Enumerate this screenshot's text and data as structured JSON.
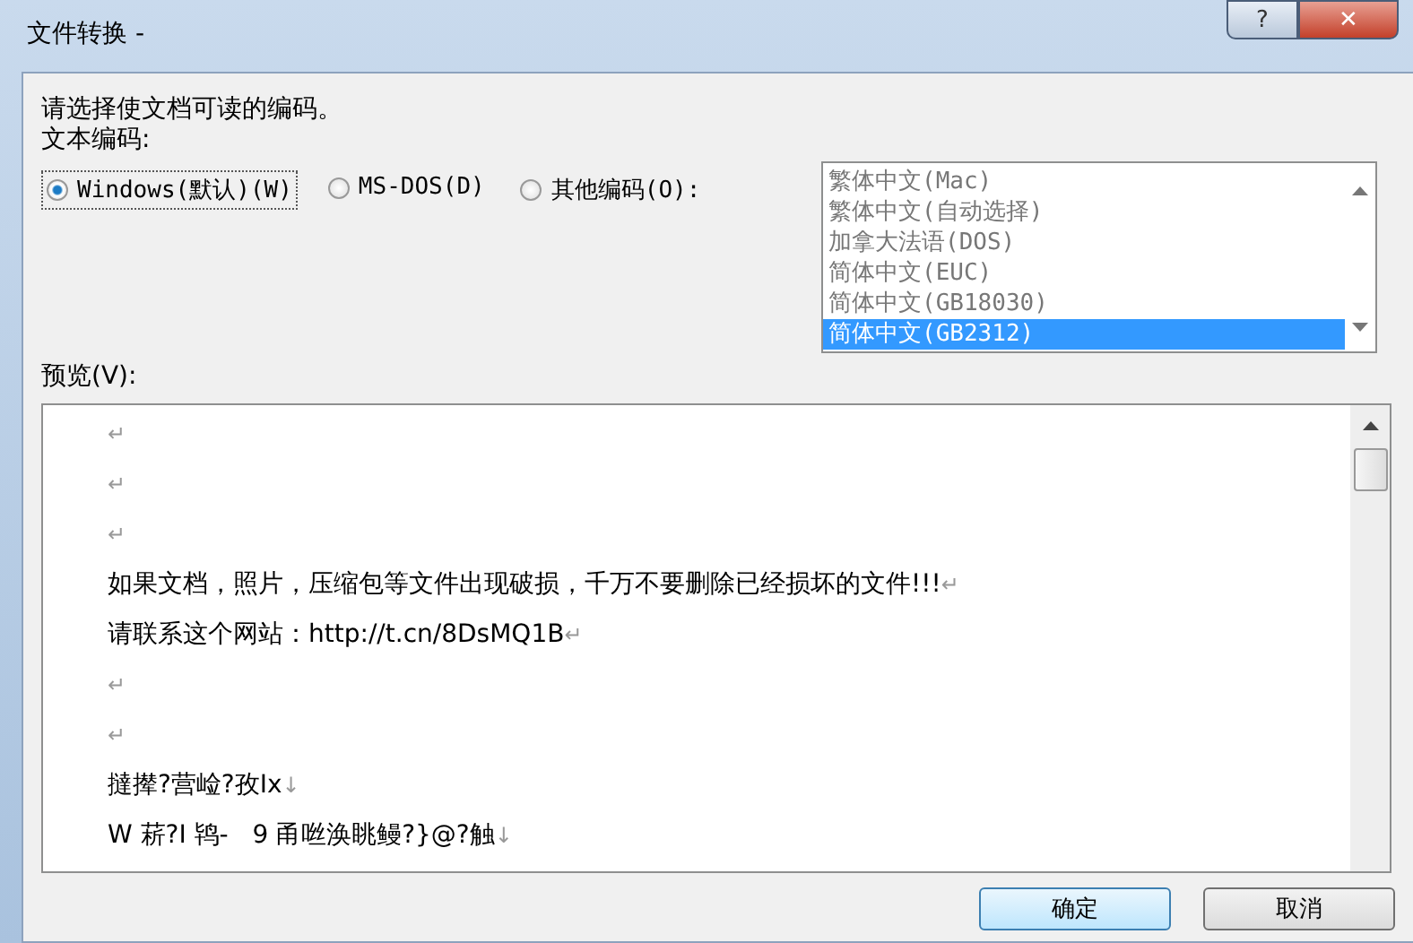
{
  "window": {
    "title": "文件转换 -",
    "help_button": "?",
    "close_button": "✕"
  },
  "instruction": "请选择使文档可读的编码。",
  "encoding_label": "文本编码:",
  "radios": [
    {
      "label": "Windows(默认)(W)",
      "selected": true
    },
    {
      "label": "MS-DOS(D)",
      "selected": false
    },
    {
      "label": "其他编码(O):",
      "selected": false
    }
  ],
  "encoding_list": [
    {
      "label": "繁体中文(Mac)",
      "selected": false
    },
    {
      "label": "繁体中文(自动选择)",
      "selected": false
    },
    {
      "label": "加拿大法语(DOS)",
      "selected": false
    },
    {
      "label": "简体中文(EUC)",
      "selected": false
    },
    {
      "label": "简体中文(GB18030)",
      "selected": false
    },
    {
      "label": "简体中文(GB2312)",
      "selected": true
    }
  ],
  "preview_label": "预览(V):",
  "preview_lines": [
    {
      "mark": "↵"
    },
    {
      "mark": "↵"
    },
    {
      "mark": "↵"
    },
    {
      "text": "如果文档，照片，压缩包等文件出现破损，千万不要删除已经损坏的文件!!!",
      "mark": "↵"
    },
    {
      "text": "请联系这个网站：http://t.cn/8DsMQ1B",
      "mark": "↵"
    },
    {
      "mark": "↵"
    },
    {
      "mark": "↵"
    },
    {
      "text": "撻撵?营崄?孜Ix",
      "mark": "↓"
    },
    {
      "text": "W 菥?I 鸨-   9 甬咝涣眺鳗?}@?触",
      "mark": "↓"
    }
  ],
  "buttons": [
    "确定",
    "取消"
  ]
}
